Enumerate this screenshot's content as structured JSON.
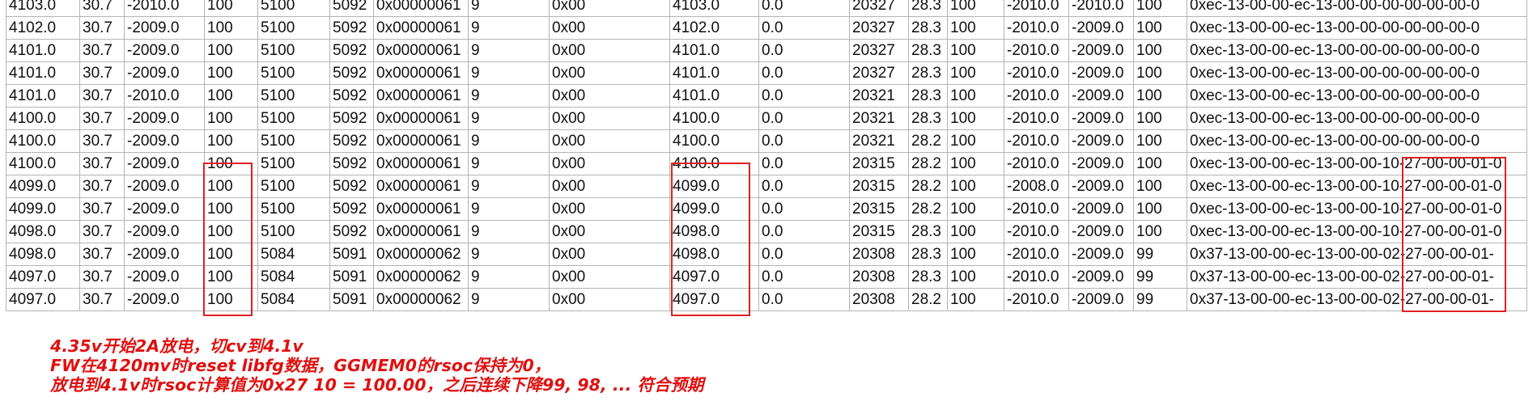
{
  "rows": [
    [
      "4103.0",
      "30.7",
      "-2010.0",
      "100",
      "5100",
      "5092",
      "0x00000061",
      "9",
      "0x00",
      "4103.0",
      "0.0",
      "20327",
      "28.3",
      "100",
      "-2010.0",
      "-2010.0",
      "100",
      "0xec-13-00-00-ec-13-00-00-00-00-00-00-0"
    ],
    [
      "4102.0",
      "30.7",
      "-2009.0",
      "100",
      "5100",
      "5092",
      "0x00000061",
      "9",
      "0x00",
      "4102.0",
      "0.0",
      "20327",
      "28.3",
      "100",
      "-2010.0",
      "-2009.0",
      "100",
      "0xec-13-00-00-ec-13-00-00-00-00-00-00-0"
    ],
    [
      "4101.0",
      "30.7",
      "-2009.0",
      "100",
      "5100",
      "5092",
      "0x00000061",
      "9",
      "0x00",
      "4101.0",
      "0.0",
      "20327",
      "28.3",
      "100",
      "-2010.0",
      "-2009.0",
      "100",
      "0xec-13-00-00-ec-13-00-00-00-00-00-00-0"
    ],
    [
      "4101.0",
      "30.7",
      "-2009.0",
      "100",
      "5100",
      "5092",
      "0x00000061",
      "9",
      "0x00",
      "4101.0",
      "0.0",
      "20327",
      "28.3",
      "100",
      "-2010.0",
      "-2009.0",
      "100",
      "0xec-13-00-00-ec-13-00-00-00-00-00-00-0"
    ],
    [
      "4101.0",
      "30.7",
      "-2010.0",
      "100",
      "5100",
      "5092",
      "0x00000061",
      "9",
      "0x00",
      "4101.0",
      "0.0",
      "20321",
      "28.3",
      "100",
      "-2010.0",
      "-2009.0",
      "100",
      "0xec-13-00-00-ec-13-00-00-00-00-00-00-0"
    ],
    [
      "4100.0",
      "30.7",
      "-2009.0",
      "100",
      "5100",
      "5092",
      "0x00000061",
      "9",
      "0x00",
      "4100.0",
      "0.0",
      "20321",
      "28.3",
      "100",
      "-2010.0",
      "-2009.0",
      "100",
      "0xec-13-00-00-ec-13-00-00-00-00-00-00-0"
    ],
    [
      "4100.0",
      "30.7",
      "-2009.0",
      "100",
      "5100",
      "5092",
      "0x00000061",
      "9",
      "0x00",
      "4100.0",
      "0.0",
      "20321",
      "28.2",
      "100",
      "-2010.0",
      "-2009.0",
      "100",
      "0xec-13-00-00-ec-13-00-00-00-00-00-00-0"
    ],
    [
      "4100.0",
      "30.7",
      "-2009.0",
      "100",
      "5100",
      "5092",
      "0x00000061",
      "9",
      "0x00",
      "4100.0",
      "0.0",
      "20315",
      "28.2",
      "100",
      "-2010.0",
      "-2009.0",
      "100",
      "0xec-13-00-00-ec-13-00-00-10-27-00-00-01-0"
    ],
    [
      "4099.0",
      "30.7",
      "-2009.0",
      "100",
      "5100",
      "5092",
      "0x00000061",
      "9",
      "0x00",
      "4099.0",
      "0.0",
      "20315",
      "28.2",
      "100",
      "-2008.0",
      "-2009.0",
      "100",
      "0xec-13-00-00-ec-13-00-00-10-27-00-00-01-0"
    ],
    [
      "4099.0",
      "30.7",
      "-2009.0",
      "100",
      "5100",
      "5092",
      "0x00000061",
      "9",
      "0x00",
      "4099.0",
      "0.0",
      "20315",
      "28.2",
      "100",
      "-2010.0",
      "-2009.0",
      "100",
      "0xec-13-00-00-ec-13-00-00-10-27-00-00-01-0"
    ],
    [
      "4098.0",
      "30.7",
      "-2009.0",
      "100",
      "5100",
      "5092",
      "0x00000061",
      "9",
      "0x00",
      "4098.0",
      "0.0",
      "20315",
      "28.3",
      "100",
      "-2010.0",
      "-2009.0",
      "100",
      "0xec-13-00-00-ec-13-00-00-10-27-00-00-01-0"
    ],
    [
      "4098.0",
      "30.7",
      "-2009.0",
      "100",
      "5084",
      "5091",
      "0x00000062",
      "9",
      "0x00",
      "4098.0",
      "0.0",
      "20308",
      "28.3",
      "100",
      "-2010.0",
      "-2009.0",
      "99",
      "0x37-13-00-00-ec-13-00-00-02-27-00-00-01-"
    ],
    [
      "4097.0",
      "30.7",
      "-2009.0",
      "100",
      "5084",
      "5091",
      "0x00000062",
      "9",
      "0x00",
      "4097.0",
      "0.0",
      "20308",
      "28.3",
      "100",
      "-2010.0",
      "-2009.0",
      "99",
      "0x37-13-00-00-ec-13-00-00-02-27-00-00-01-"
    ],
    [
      "4097.0",
      "30.7",
      "-2009.0",
      "100",
      "5084",
      "5091",
      "0x00000062",
      "9",
      "0x00",
      "4097.0",
      "0.0",
      "20308",
      "28.2",
      "100",
      "-2010.0",
      "-2009.0",
      "99",
      "0x37-13-00-00-ec-13-00-00-02-27-00-00-01-"
    ]
  ],
  "notes": {
    "line1": "4.35v开始2A放电，切cv到4.1v",
    "line2": "FW在4120mv时reset libfg数据，GGMEM0的rsoc保持为0，",
    "line3": "放电到4.1v时rsoc计算值为0x27 10 = 100.00，之后连续下降99, 98, ... 符合预期"
  },
  "colors": {
    "highlight": "#e02020",
    "note_text": "#e01010",
    "grid": "#b4b4b4"
  }
}
